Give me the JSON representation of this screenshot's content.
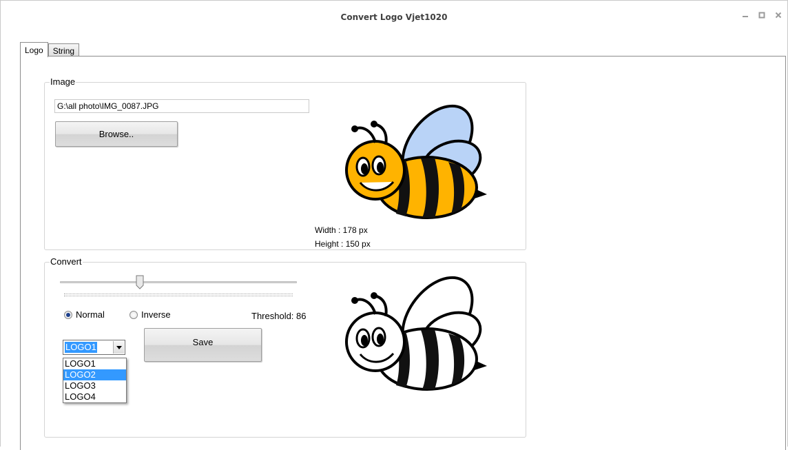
{
  "window": {
    "title": "Convert Logo Vjet1020"
  },
  "tabs": [
    {
      "label": "Logo"
    },
    {
      "label": "String"
    }
  ],
  "image_group": {
    "legend": "Image",
    "path_value": "G:\\all photo\\IMG_0087.JPG",
    "browse_label": "Browse..",
    "width_text": "Width  :  178 px",
    "height_text": "Height :  150 px"
  },
  "convert_group": {
    "legend": "Convert",
    "threshold_text": "Threshold: 86",
    "threshold_value": 86,
    "radio_normal": "Normal",
    "radio_inverse": "Inverse",
    "selected_mode": "Normal",
    "combo_value": "LOGO1",
    "combo_options": [
      "LOGO1",
      "LOGO2",
      "LOGO3",
      "LOGO4"
    ],
    "highlighted_option": "LOGO2",
    "save_label": "Save"
  },
  "colors": {
    "selection_blue": "#3399ff",
    "bee_yellow": "#ffb300",
    "bee_wing": "#b9d3f7"
  }
}
